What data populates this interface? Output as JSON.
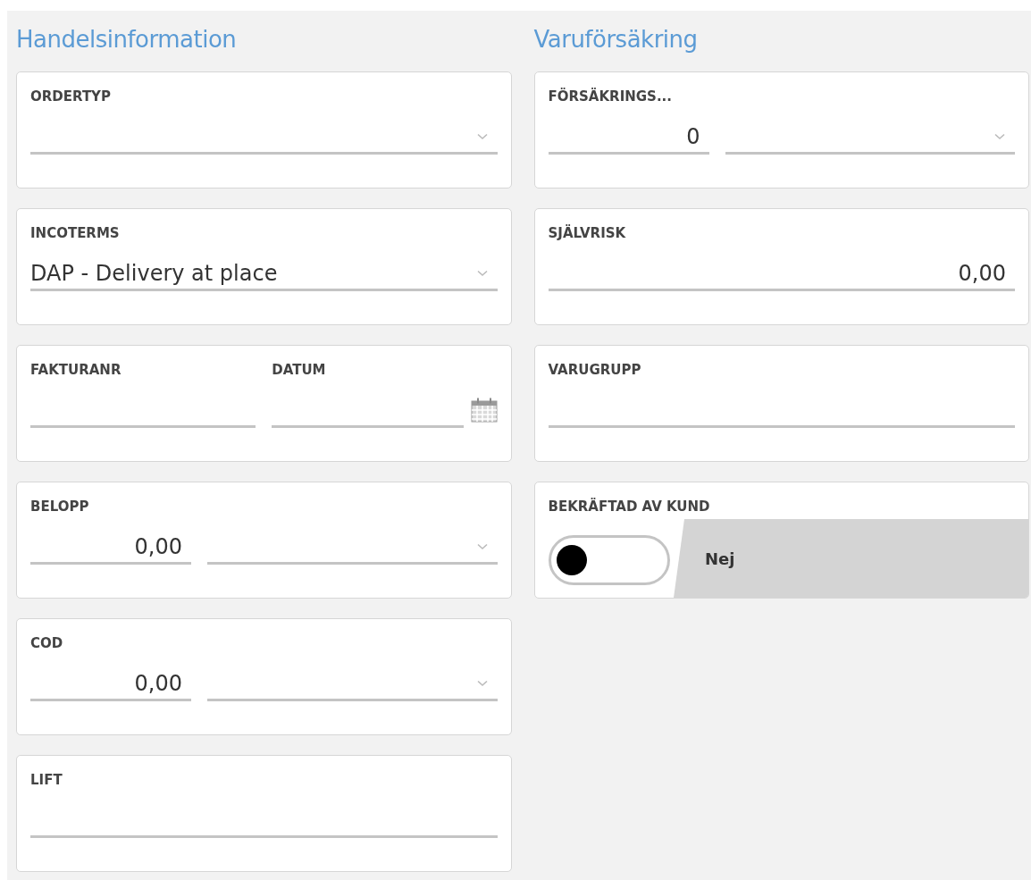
{
  "columns": [
    {
      "heading": "Handelsinformation",
      "cards": [
        {
          "kind": "fields",
          "fields": [
            {
              "kind": "select",
              "label": "ORDERTYP"
            }
          ]
        },
        {
          "kind": "fields",
          "fields": [
            {
              "kind": "select",
              "label": "INCOTERMS",
              "value": "DAP - Delivery at place"
            }
          ]
        },
        {
          "kind": "fields",
          "fields": [
            {
              "kind": "text",
              "label": "FAKTURANR"
            },
            {
              "kind": "date",
              "label": "DATUM"
            }
          ]
        },
        {
          "kind": "fields",
          "fields": [
            {
              "kind": "number",
              "label": "BELOPP",
              "value": "0,00"
            },
            {
              "kind": "select"
            }
          ]
        },
        {
          "kind": "fields",
          "fields": [
            {
              "kind": "number",
              "label": "COD",
              "value": "0,00"
            },
            {
              "kind": "select"
            }
          ]
        },
        {
          "kind": "fields",
          "fields": [
            {
              "kind": "text",
              "label": "LIFT"
            }
          ]
        }
      ]
    },
    {
      "heading": "Varuförsäkring",
      "cards": [
        {
          "kind": "fields",
          "fields": [
            {
              "kind": "number",
              "label": "FÖRSÄKRINGS...",
              "value": "0"
            },
            {
              "kind": "select"
            }
          ]
        },
        {
          "kind": "fields",
          "fields": [
            {
              "kind": "numberwide",
              "label": "SJÄLVRISK",
              "value": "0,00"
            }
          ]
        },
        {
          "kind": "fields",
          "fields": [
            {
              "kind": "text",
              "label": "VARUGRUPP"
            }
          ]
        },
        {
          "kind": "toggle",
          "label": "BEKRÄFTAD AV KUND",
          "on": false,
          "state_text": "Nej"
        }
      ]
    }
  ]
}
